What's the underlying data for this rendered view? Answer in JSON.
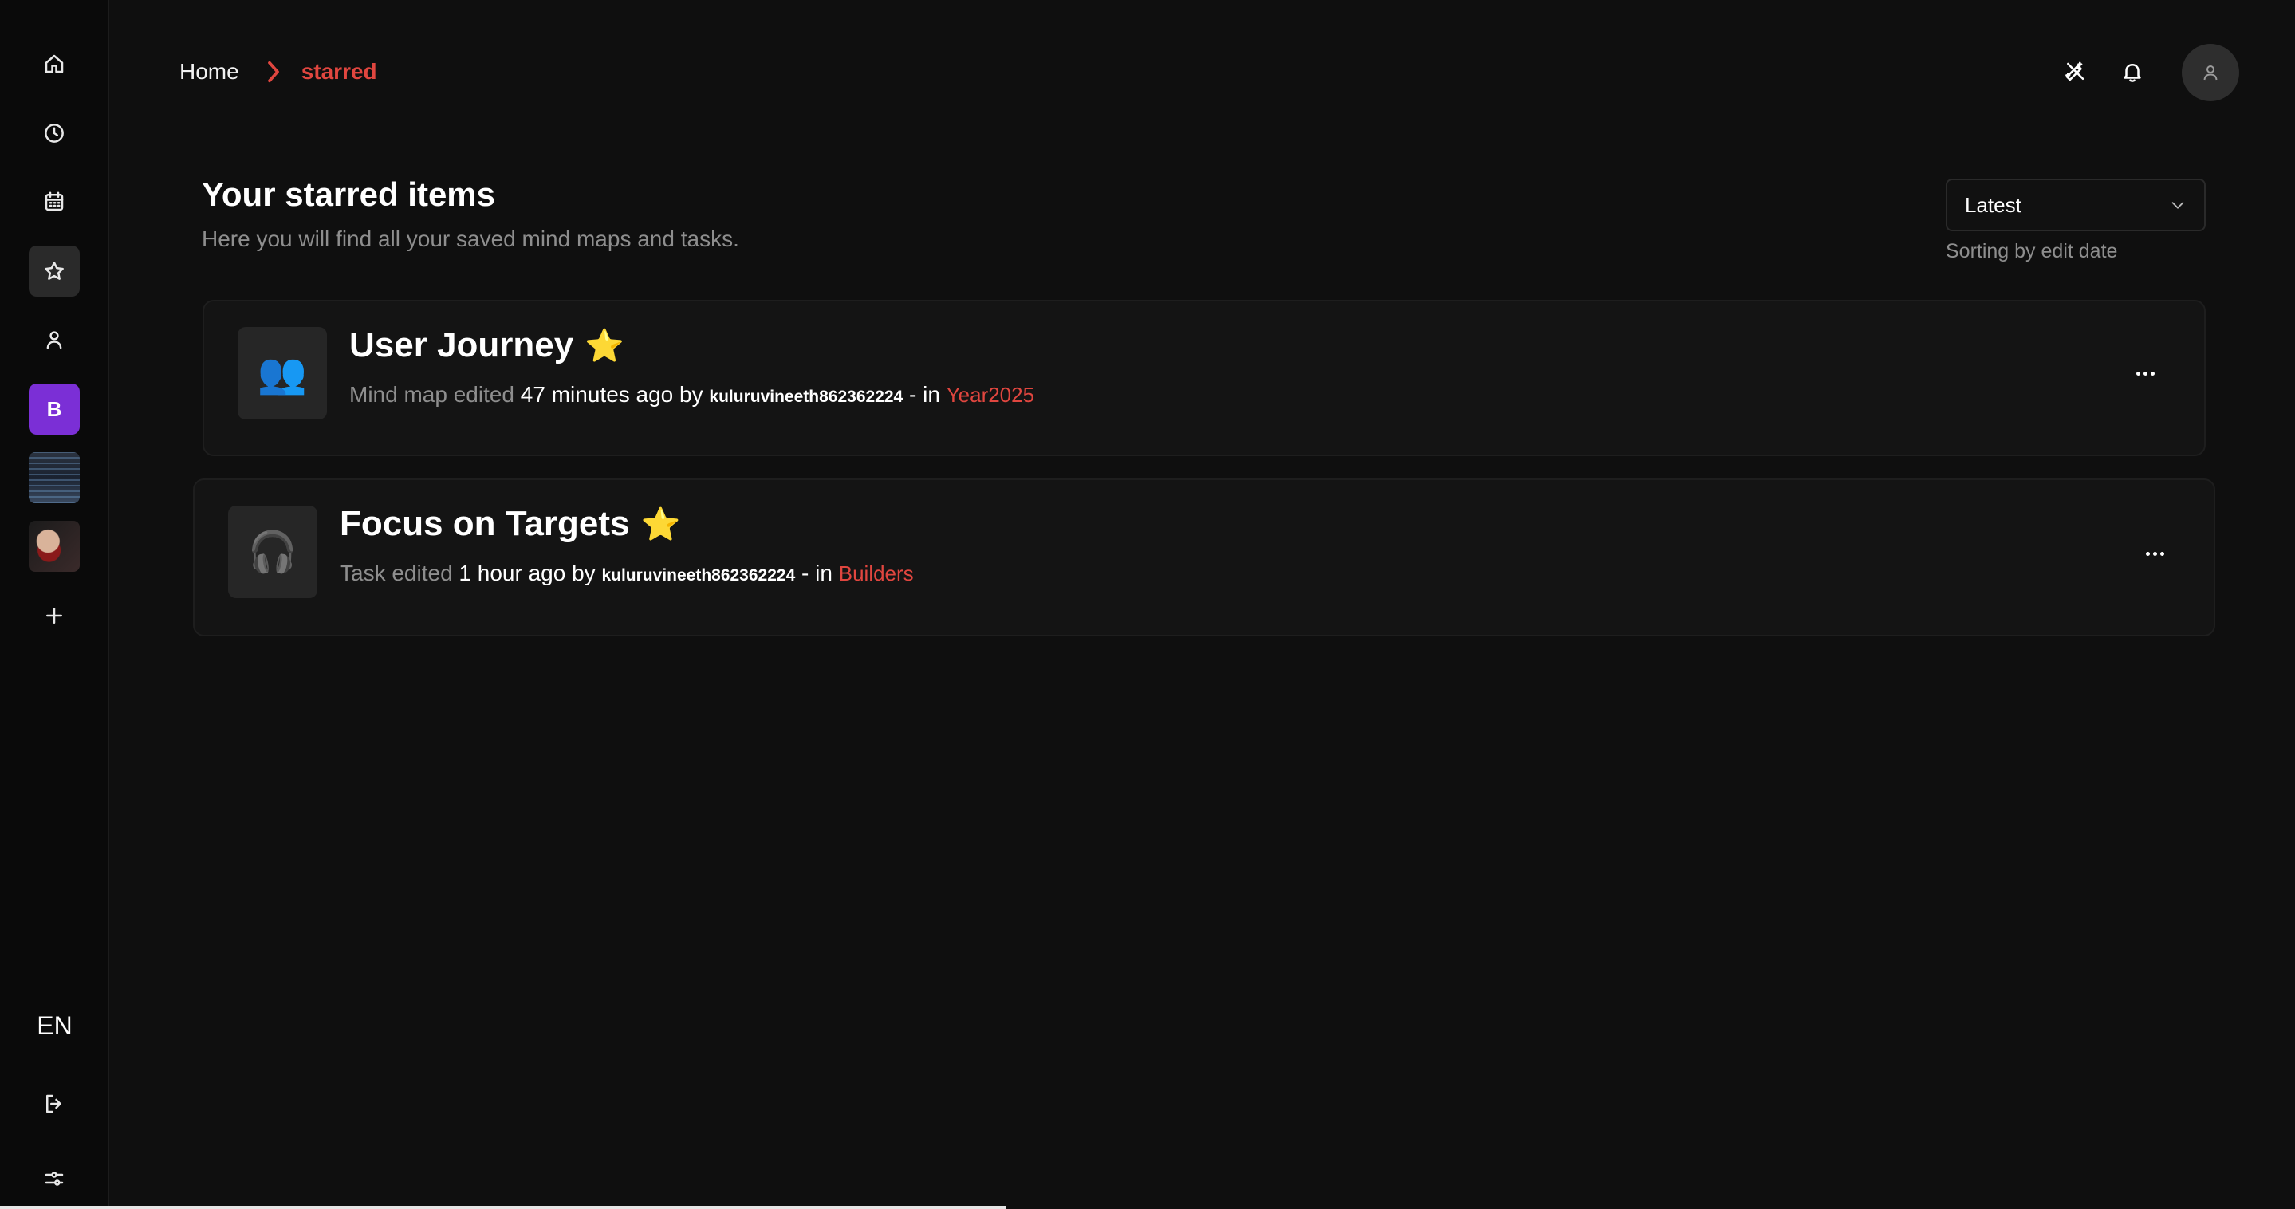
{
  "sidebar": {
    "workspace_letter": "B",
    "language": "EN",
    "icons": [
      "home-icon",
      "clock-icon",
      "calendar-icon",
      "star-icon",
      "user-icon",
      "plus-icon",
      "logout-icon",
      "settings-sliders-icon"
    ]
  },
  "header": {
    "breadcrumb": {
      "home": "Home",
      "current": "starred"
    },
    "icons": [
      "magic-pencil-icon",
      "bell-icon",
      "user-avatar-icon"
    ]
  },
  "main": {
    "title": "Your starred items",
    "subtitle": "Here you will find all your saved mind maps and tasks.",
    "sort": {
      "selected": "Latest",
      "hint": "Sorting by edit date"
    },
    "items": [
      {
        "emoji": "👥",
        "title": "User Journey",
        "star": "⭐",
        "type_text": "Mind map edited",
        "time": "47 minutes ago",
        "by": "by",
        "user": "kuluruvineeth862362224",
        "in": "- in",
        "workspace": "Year2025"
      },
      {
        "emoji": "🎧",
        "title": "Focus on Targets",
        "star": "⭐",
        "type_text": "Task edited",
        "time": "1 hour ago",
        "by": "by",
        "user": "kuluruvineeth862362224",
        "in": "- in",
        "workspace": "Builders"
      }
    ]
  },
  "colors": {
    "accent": "#e0463f",
    "workspace_purple": "#7b2fd6",
    "star": "#f6c342",
    "background": "#0f0f0f"
  }
}
